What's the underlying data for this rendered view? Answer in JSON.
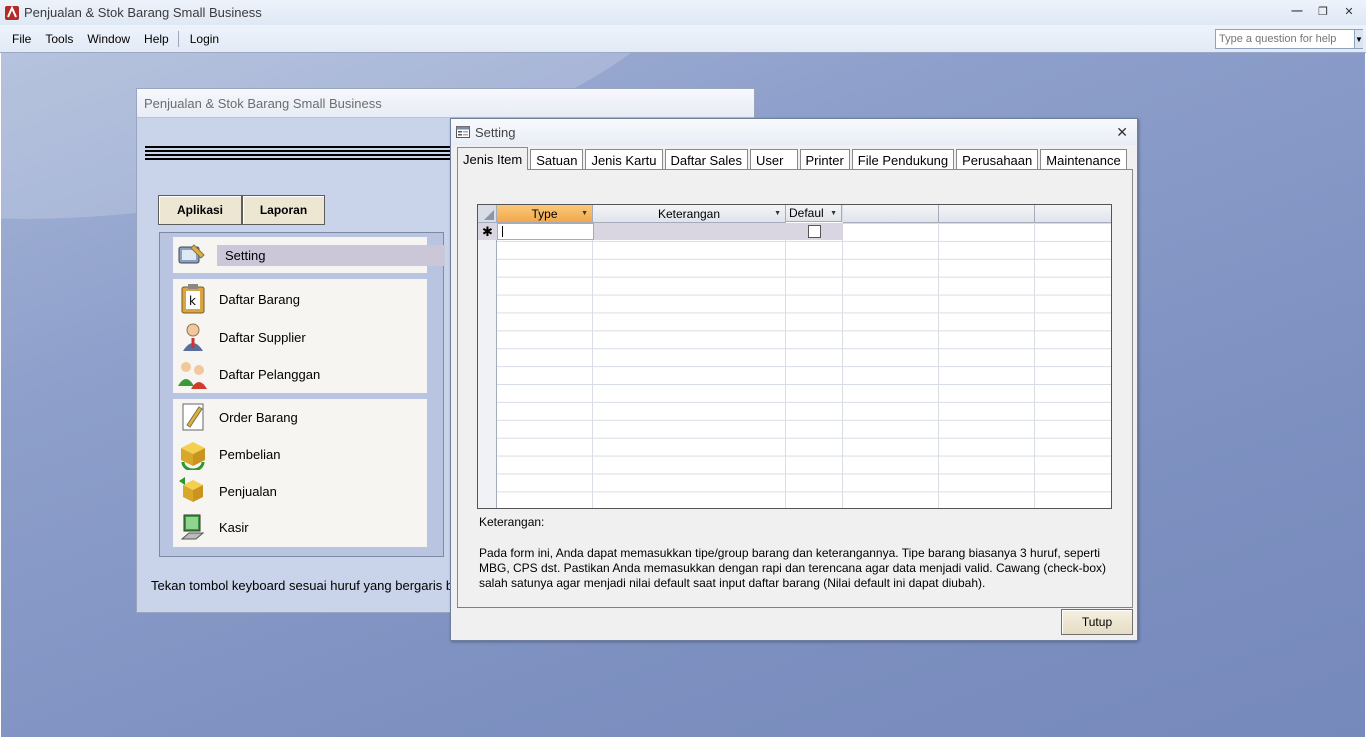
{
  "app": {
    "title": "Penjualan & Stok Barang Small Business",
    "controls": [
      "minimize-icon",
      "restore-icon",
      "close-icon"
    ]
  },
  "menubar": {
    "items": [
      {
        "label": "File"
      },
      {
        "label": "Tools"
      },
      {
        "label": "Window"
      },
      {
        "label": "Help"
      },
      {
        "label": "Login"
      }
    ],
    "help_placeholder": "Type a question for help"
  },
  "mainform": {
    "title": "Penjualan & Stok Barang Small Business",
    "buttons": {
      "aplikasi": "Aplikasi",
      "laporan": "Laporan"
    },
    "items": [
      {
        "label": "Setting",
        "icon": "tools-icon"
      },
      {
        "label": "Daftar Barang",
        "icon": "clipboard-icon"
      },
      {
        "label": "Daftar Supplier",
        "icon": "person-icon"
      },
      {
        "label": "Daftar Pelanggan",
        "icon": "people-icon"
      },
      {
        "label": "Order Barang",
        "icon": "notepad-icon"
      },
      {
        "label": "Pembelian",
        "icon": "box-arrow-icon"
      },
      {
        "label": "Penjualan",
        "icon": "box-icon"
      },
      {
        "label": "Kasir",
        "icon": "computer-icon"
      }
    ],
    "footer": "Tekan tombol keyboard sesuai huruf yang bergaris b"
  },
  "dialog": {
    "title": "Setting",
    "tabs": [
      "Jenis Item",
      "Satuan",
      "Jenis Kartu",
      "Daftar Sales",
      "User",
      "Printer",
      "File Pendukung",
      "Perusahaan",
      "Maintenance"
    ],
    "active_tab": "Jenis Item",
    "grid": {
      "columns": [
        "Type",
        "Keterangan",
        "Defaul"
      ],
      "new_row_marker": "✱"
    },
    "keterangan_label": "Keterangan:",
    "keterangan_text": "Pada form ini, Anda dapat memasukkan tipe/group barang dan keterangannya. Tipe barang biasanya 3 huruf, seperti MBG, CPS dst. Pastikan Anda memasukkan dengan rapi dan terencana agar data menjadi valid. Cawang (check-box) salah satunya agar menjadi nilai default saat input daftar barang (Nilai default ini dapat diubah).",
    "close_button": "Tutup"
  }
}
